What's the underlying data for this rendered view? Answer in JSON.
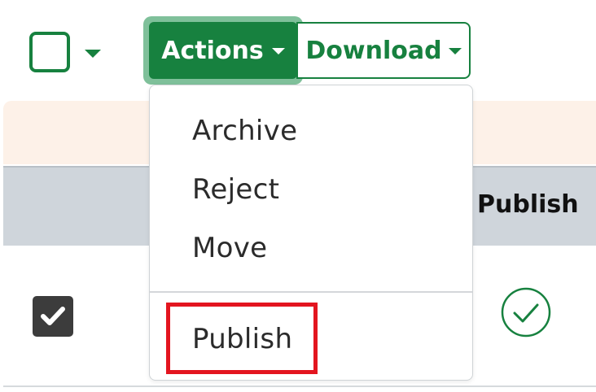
{
  "toolbar": {
    "select_all_icon": "empty-checkbox",
    "actions_label": "Actions",
    "download_label": "Download"
  },
  "table": {
    "columns": [
      "Publish"
    ],
    "rows": [
      {
        "selected": true,
        "publish_status_icon": "check-circle-icon"
      }
    ]
  },
  "actions_menu": {
    "items": [
      {
        "label": "Archive"
      },
      {
        "label": "Reject"
      },
      {
        "label": "Move"
      },
      {
        "label": "Publish"
      }
    ],
    "highlighted_item": "Publish"
  },
  "colors": {
    "primary_green": "#17813f",
    "highlight_red": "#e3151f",
    "notice_bg": "#fdf1e8",
    "header_bg": "#cfd5db"
  }
}
